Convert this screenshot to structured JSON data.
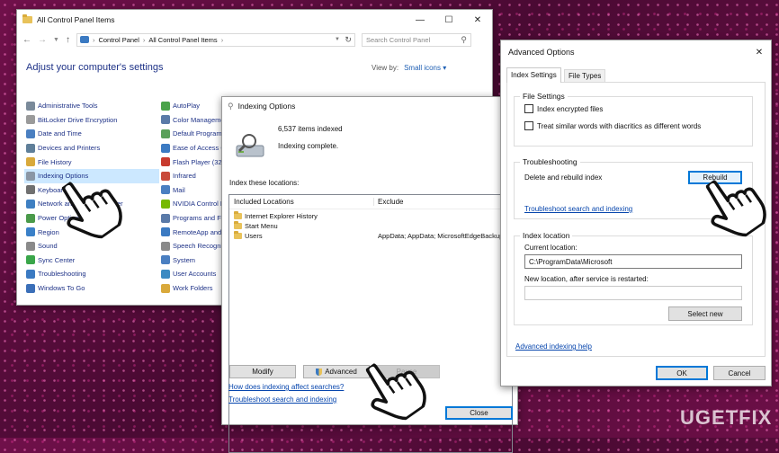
{
  "control_panel": {
    "title": "All Control Panel Items",
    "breadcrumb": [
      "Control Panel",
      "All Control Panel Items"
    ],
    "search_placeholder": "Search Control Panel",
    "heading": "Adjust your computer's settings",
    "view_by_label": "View by:",
    "view_by_value": "Small icons",
    "col1": [
      {
        "label": "Administrative Tools",
        "color": "#7a8a9a"
      },
      {
        "label": "BitLocker Drive Encryption",
        "color": "#9a9a9a"
      },
      {
        "label": "Date and Time",
        "color": "#4a7fc1"
      },
      {
        "label": "Devices and Printers",
        "color": "#5f7f99"
      },
      {
        "label": "File History",
        "color": "#d9a93b"
      },
      {
        "label": "Indexing Options",
        "color": "#8a96a5"
      },
      {
        "label": "Keyboard",
        "color": "#707070"
      },
      {
        "label": "Network and Sharing Center",
        "color": "#3e7fc2"
      },
      {
        "label": "Power Options",
        "color": "#4a9a4a"
      },
      {
        "label": "Region",
        "color": "#3a80c8"
      },
      {
        "label": "Sound",
        "color": "#8a8a8a"
      },
      {
        "label": "Sync Center",
        "color": "#3aa64a"
      },
      {
        "label": "Troubleshooting",
        "color": "#3b7ac2"
      },
      {
        "label": "Windows To Go",
        "color": "#3b6fb8"
      }
    ],
    "col2": [
      {
        "label": "AutoPlay",
        "color": "#4aa34a"
      },
      {
        "label": "Color Management",
        "color": "#5a7aa8"
      },
      {
        "label": "Default Programs",
        "color": "#5aa05a"
      },
      {
        "label": "Ease of Access Center",
        "color": "#3b7ac2"
      },
      {
        "label": "Flash Player (32-bit)",
        "color": "#c73a2e"
      },
      {
        "label": "Infrared",
        "color": "#c94a3a"
      },
      {
        "label": "Mail",
        "color": "#4a7fc1"
      },
      {
        "label": "NVIDIA Control Panel",
        "color": "#76b900"
      },
      {
        "label": "Programs and Features",
        "color": "#5a7aa8"
      },
      {
        "label": "RemoteApp and Desktop Connections",
        "color": "#3b7ac2"
      },
      {
        "label": "Speech Recognition",
        "color": "#8a8a8a"
      },
      {
        "label": "System",
        "color": "#4a7fc1"
      },
      {
        "label": "User Accounts",
        "color": "#3b8ac2"
      },
      {
        "label": "Work Folders",
        "color": "#d9a93b"
      }
    ]
  },
  "indexing": {
    "title": "Indexing Options",
    "items_indexed": "6,537 items indexed",
    "status": "Indexing complete.",
    "locations_label": "Index these locations:",
    "col_included": "Included Locations",
    "col_exclude": "Exclude",
    "rows": [
      {
        "location": "Internet Explorer History",
        "exclude": ""
      },
      {
        "location": "Start Menu",
        "exclude": ""
      },
      {
        "location": "Users",
        "exclude": "AppData; AppData; MicrosoftEdgeBackups"
      }
    ],
    "modify": "Modify",
    "advanced": "Advanced",
    "pause": "Pause",
    "link1": "How does indexing affect searches?",
    "link2": "Troubleshoot search and indexing",
    "close": "Close"
  },
  "advanced": {
    "title": "Advanced Options",
    "tabs": [
      "Index Settings",
      "File Types"
    ],
    "file_settings": "File Settings",
    "check1": "Index encrypted files",
    "check2": "Treat similar words with diacritics as different words",
    "troubleshooting": "Troubleshooting",
    "delete_rebuild": "Delete and rebuild index",
    "rebuild": "Rebuild",
    "troubleshoot_link": "Troubleshoot search and indexing",
    "index_location": "Index location",
    "current_location_label": "Current location:",
    "current_location_value": "C:\\ProgramData\\Microsoft",
    "new_location_label": "New location, after service is restarted:",
    "new_location_value": "",
    "select_new": "Select new",
    "help_link": "Advanced indexing help",
    "ok": "OK",
    "cancel": "Cancel"
  },
  "watermark": "UGETFIX"
}
